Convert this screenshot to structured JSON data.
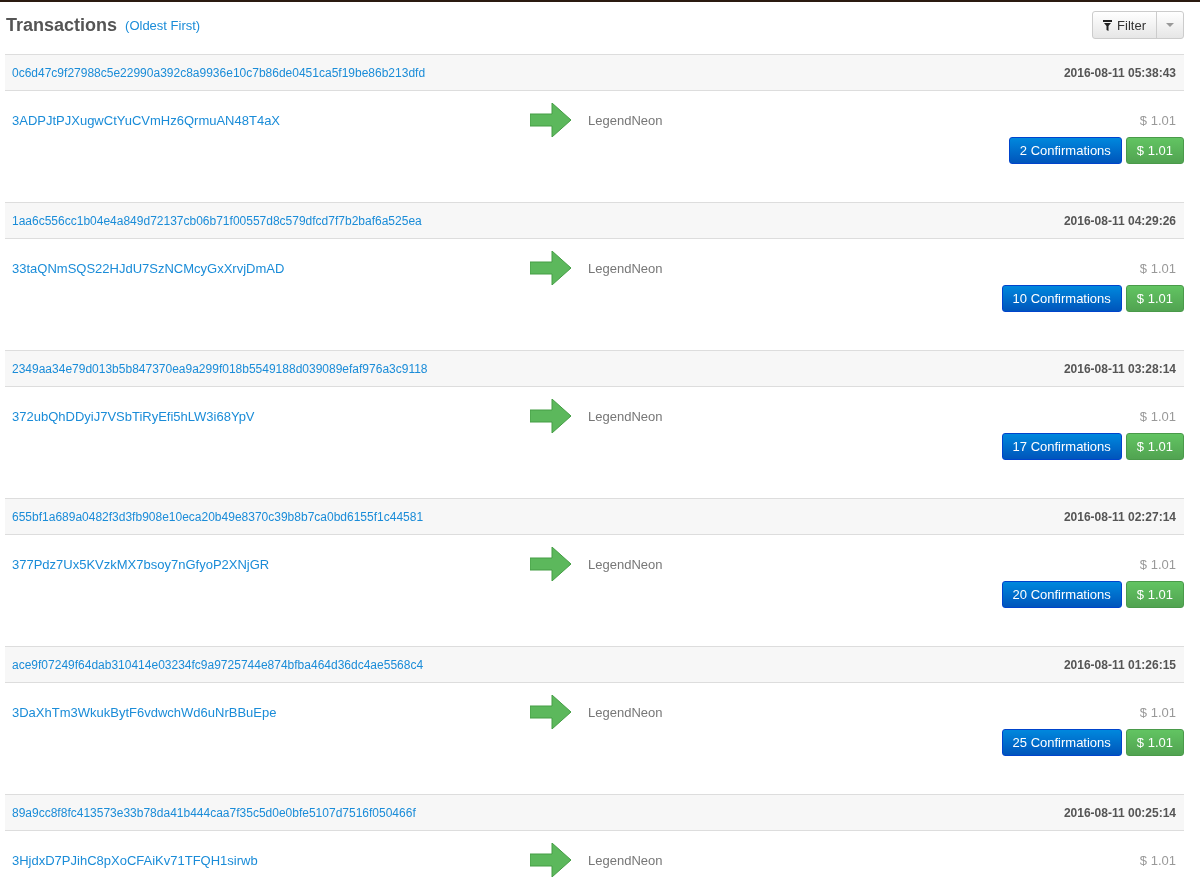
{
  "header": {
    "title": "Transactions",
    "sort_link": "(Oldest First)",
    "filter_button": "Filter"
  },
  "transactions": [
    {
      "hash": "0c6d47c9f27988c5e22990a392c8a9936e10c7b86de0451ca5f19be86b213dfd",
      "time": "2016-08-11 05:38:43",
      "from": "3ADPJtPJXugwCtYuCVmHz6QrmuAN48T4aX",
      "to": "LegendNeon",
      "amount": "$ 1.01",
      "confirmations": "2 Confirmations",
      "total": "$ 1.01"
    },
    {
      "hash": "1aa6c556cc1b04e4a849d72137cb06b71f00557d8c579dfcd7f7b2baf6a525ea",
      "time": "2016-08-11 04:29:26",
      "from": "33taQNmSQS22HJdU7SzNCMcyGxXrvjDmAD",
      "to": "LegendNeon",
      "amount": "$ 1.01",
      "confirmations": "10 Confirmations",
      "total": "$ 1.01"
    },
    {
      "hash": "2349aa34e79d013b5b847370ea9a299f018b5549188d039089efaf976a3c9118",
      "time": "2016-08-11 03:28:14",
      "from": "372ubQhDDyiJ7VSbTiRyEfi5hLW3i68YpV",
      "to": "LegendNeon",
      "amount": "$ 1.01",
      "confirmations": "17 Confirmations",
      "total": "$ 1.01"
    },
    {
      "hash": "655bf1a689a0482f3d3fb908e10eca20b49e8370c39b8b7ca0bd6155f1c44581",
      "time": "2016-08-11 02:27:14",
      "from": "377Pdz7Ux5KVzkMX7bsoy7nGfyoP2XNjGR",
      "to": "LegendNeon",
      "amount": "$ 1.01",
      "confirmations": "20 Confirmations",
      "total": "$ 1.01"
    },
    {
      "hash": "ace9f07249f64dab310414e03234fc9a9725744e874bfba464d36dc4ae5568c4",
      "time": "2016-08-11 01:26:15",
      "from": "3DaXhTm3WkukBytF6vdwchWd6uNrBBuEpe",
      "to": "LegendNeon",
      "amount": "$ 1.01",
      "confirmations": "25 Confirmations",
      "total": "$ 1.01"
    },
    {
      "hash": "89a9cc8f8fc413573e33b78da41b444caa7f35c5d0e0bfe5107d7516f050466f",
      "time": "2016-08-11 00:25:14",
      "from": "3HjdxD7PJihC8pXoCFAiKv71TFQH1sirwb",
      "to": "LegendNeon",
      "amount": "$ 1.01"
    }
  ]
}
